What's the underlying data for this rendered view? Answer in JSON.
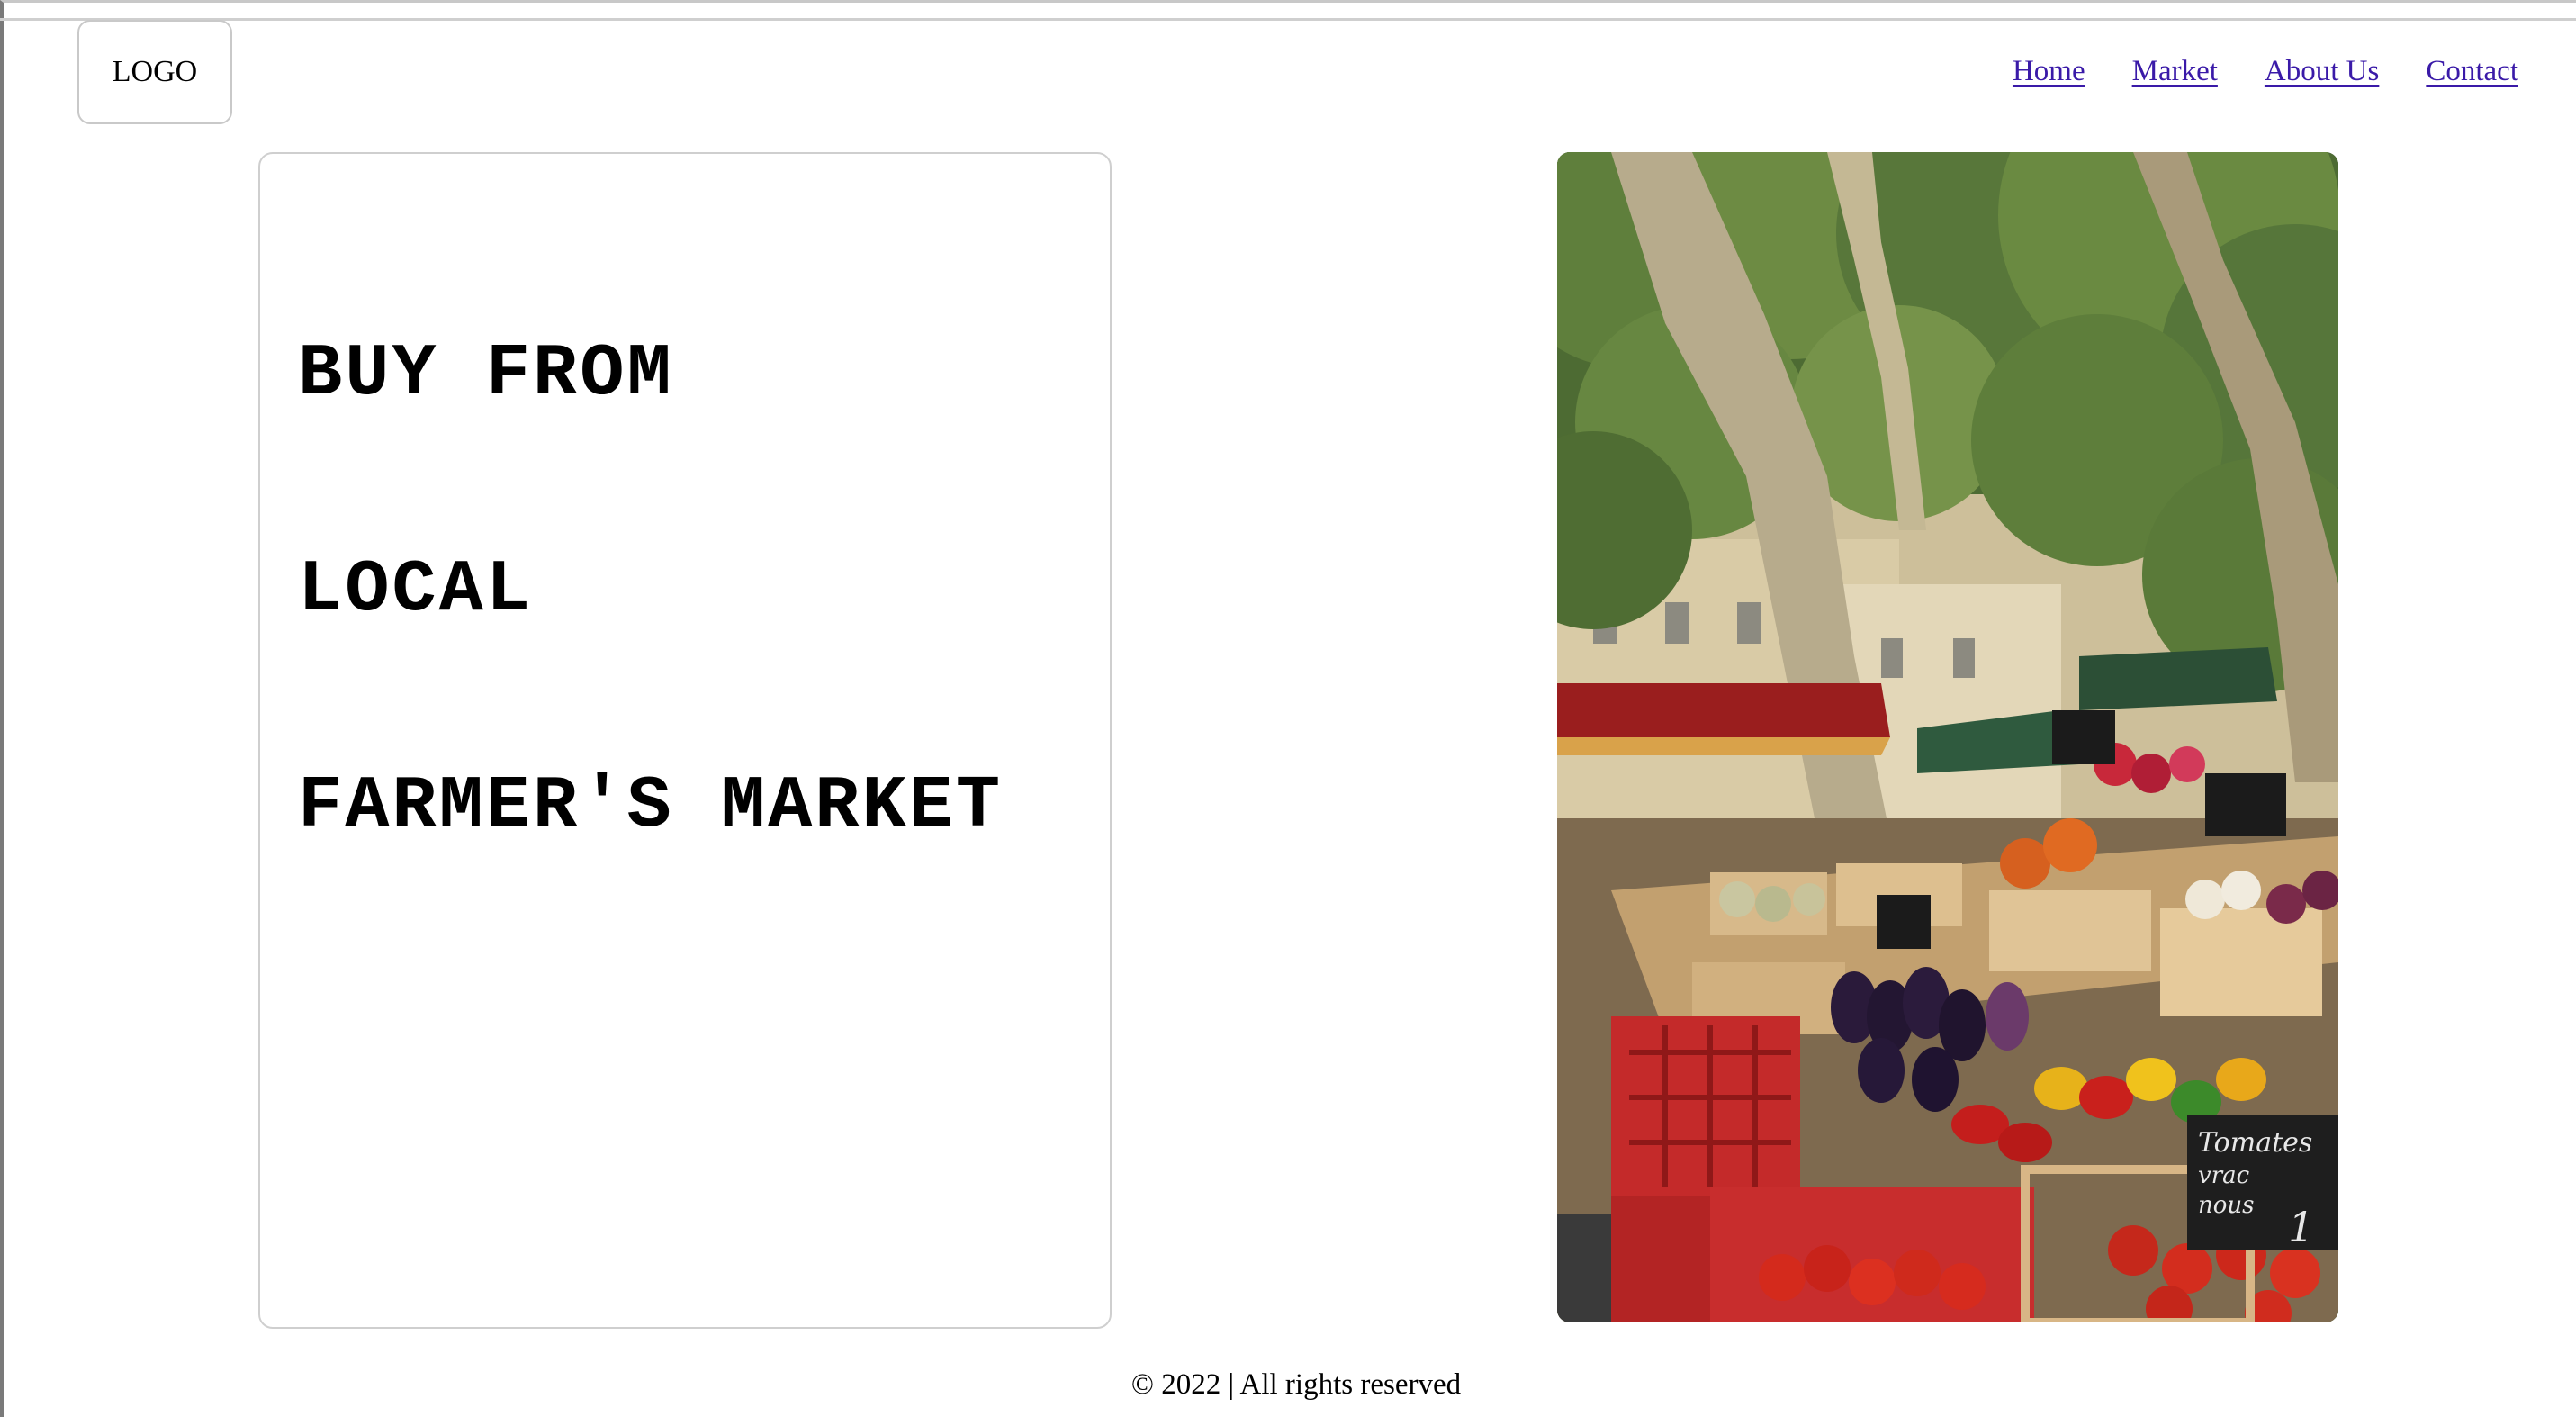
{
  "header": {
    "logo_label": "LOGO",
    "nav": [
      {
        "label": "Home"
      },
      {
        "label": "Market"
      },
      {
        "label": "About Us"
      },
      {
        "label": "Contact"
      }
    ]
  },
  "hero": {
    "headline_lines": [
      "BUY FROM",
      "LOCAL",
      "FARMER'S MARKET"
    ]
  },
  "image": {
    "alt": "Farmer's market produce stalls under trees",
    "signs": [
      "Tomates",
      "vrac",
      "nous",
      "1"
    ]
  },
  "footer": {
    "text": "© 2022 | All rights reserved"
  },
  "colors": {
    "link": "#3a1aa8",
    "text": "#000000",
    "border": "#cfcfcf"
  }
}
